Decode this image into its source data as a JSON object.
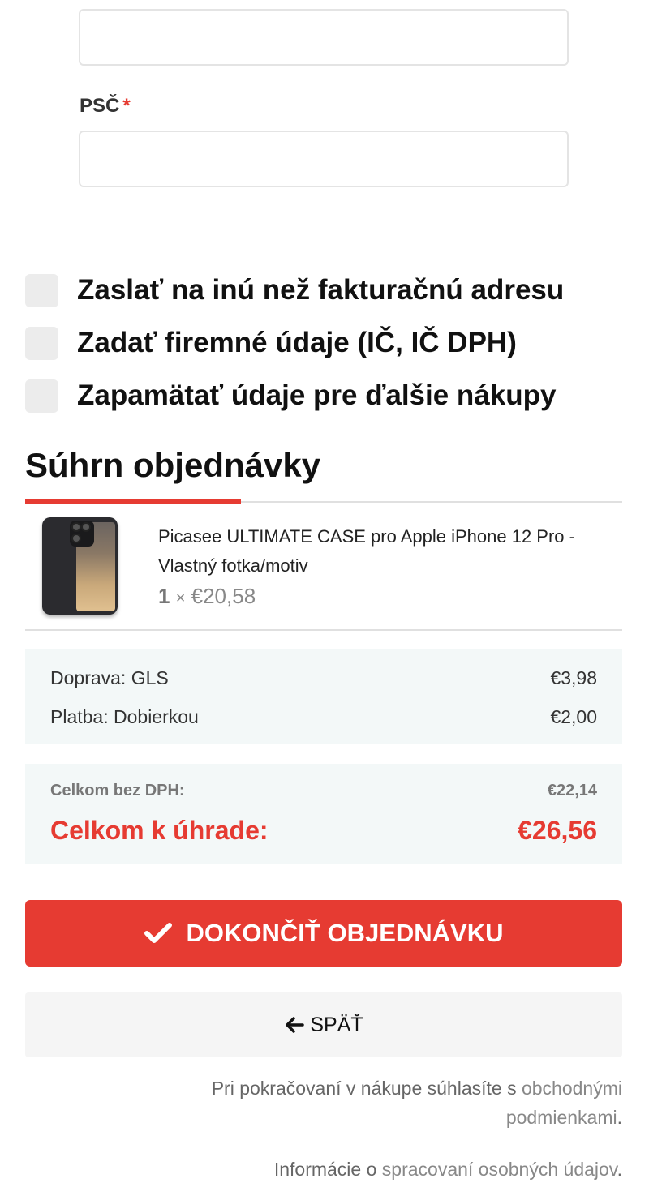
{
  "form": {
    "psc_label": "PSČ",
    "required_mark": "*"
  },
  "options": [
    {
      "label": "Zaslať na inú než fakturačnú adresu",
      "checked": false
    },
    {
      "label": "Zadať firemné údaje (IČ, IČ DPH)",
      "checked": false
    },
    {
      "label": "Zapamätať údaje pre ďalšie nákupy",
      "checked": false
    }
  ],
  "summary": {
    "title": "Súhrn objednávky",
    "product": {
      "name": "Picasee ULTIMATE CASE pro Apple iPhone 12 Pro - Vlastný fotka/motiv",
      "quantity": "1",
      "times": "×",
      "unit_price": "€20,58"
    },
    "fees": [
      {
        "label": "Doprava: GLS",
        "value": "€3,98"
      },
      {
        "label": "Platba: Dobierkou",
        "value": "€2,00"
      }
    ],
    "total_excl_vat_label": "Celkom bez DPH:",
    "total_excl_vat_value": "€22,14",
    "total_label": "Celkom k úhrade:",
    "total_value": "€26,56"
  },
  "actions": {
    "finish_label": "DOKONČIŤ OBJEDNÁVKU",
    "back_label": "SPÄŤ"
  },
  "legal": {
    "terms_prefix": "Pri pokračovaní v nákupe súhlasíte s",
    "terms_link": "obchodnými podmienkami",
    "terms_suffix": ".",
    "privacy_prefix": "Informácie o",
    "privacy_link": "spracovaní osobných údajov",
    "privacy_suffix": "."
  },
  "colors": {
    "accent": "#e63b32",
    "panel_bg": "#f3f8f8",
    "checkbox_bg": "#ececec"
  }
}
